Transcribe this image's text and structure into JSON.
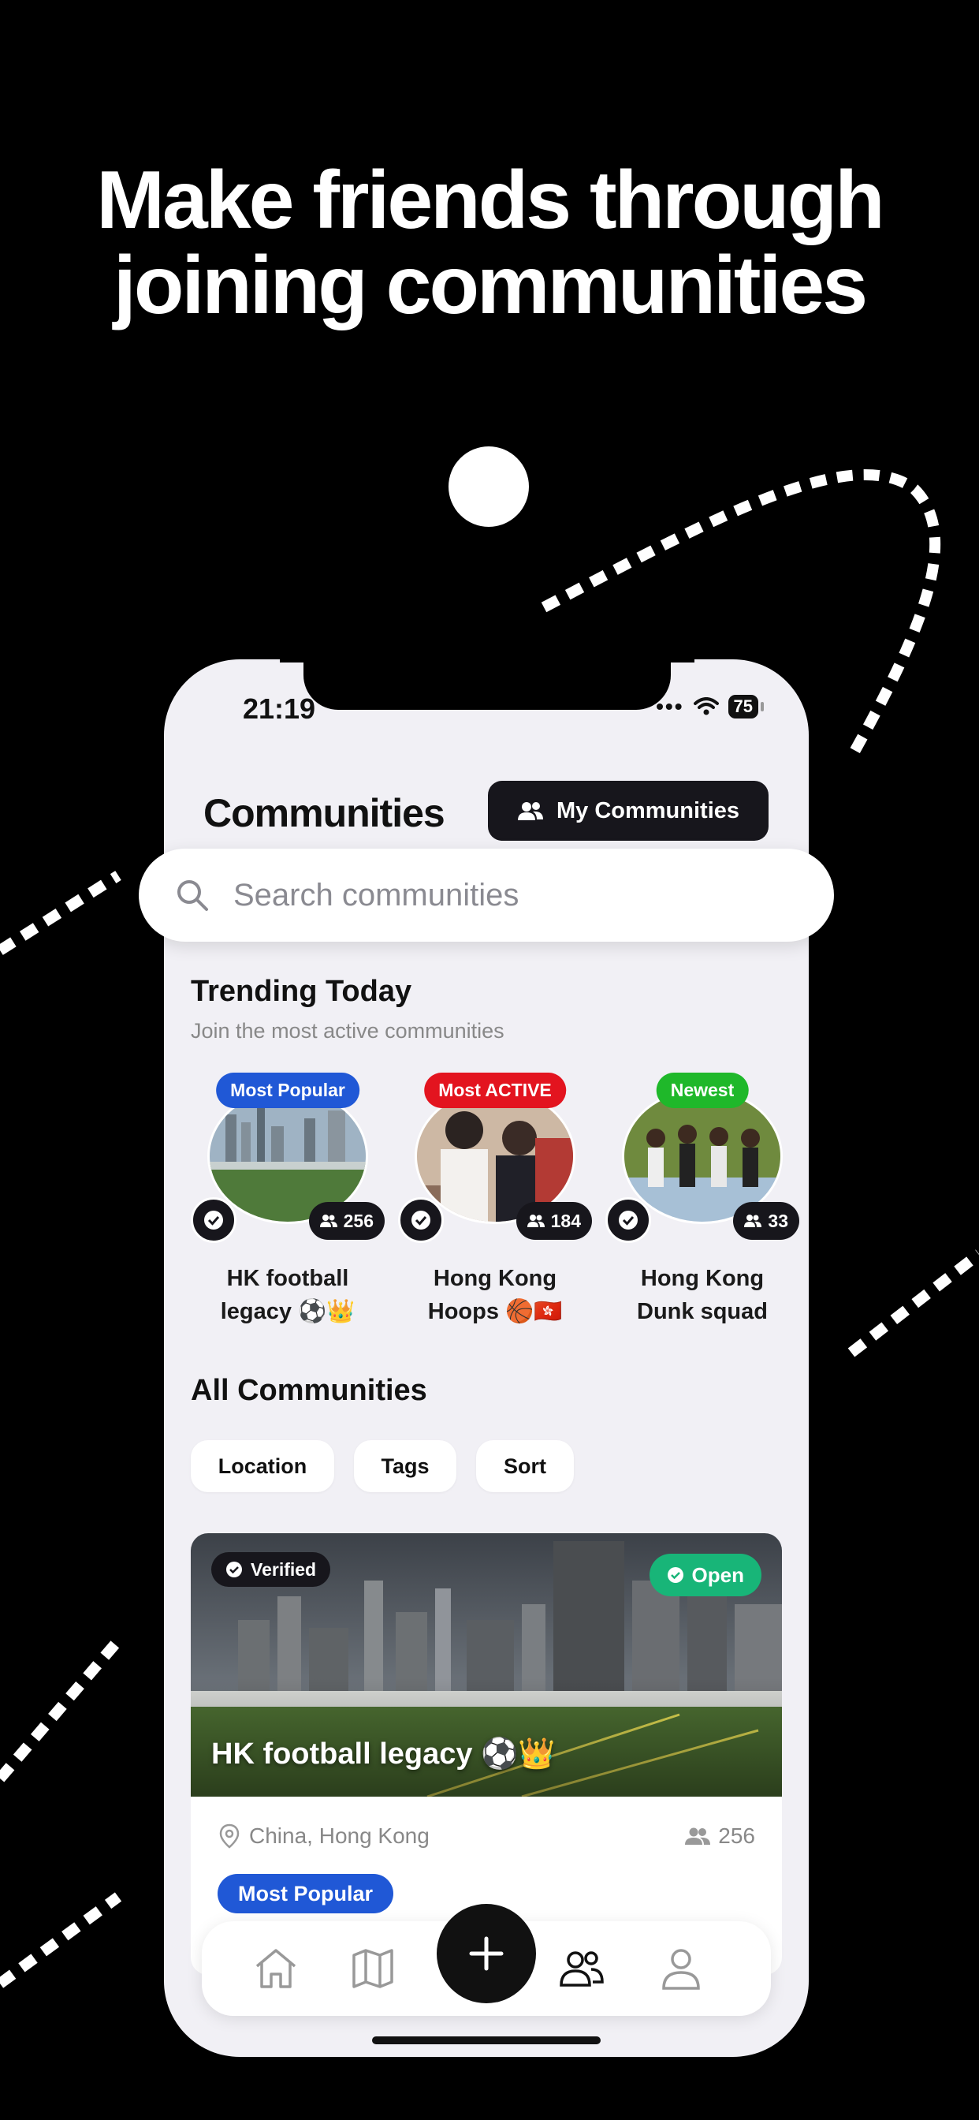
{
  "promo": {
    "headline_line1": "Make friends through",
    "headline_line2": "joining communities"
  },
  "status_bar": {
    "time": "21:19",
    "battery": "75"
  },
  "header": {
    "title": "Communities",
    "my_communities_label": "My Communities"
  },
  "search": {
    "placeholder": "Search communities"
  },
  "trending": {
    "title": "Trending Today",
    "subtitle": "Join the most active communities",
    "items": [
      {
        "badge": "Most Popular",
        "badge_color": "#2058d6",
        "count": "256",
        "name_line1": "HK football",
        "name_line2": "legacy ⚽️👑"
      },
      {
        "badge": "Most ACTIVE",
        "badge_color": "#e3141f",
        "count": "184",
        "name_line1": "Hong Kong",
        "name_line2": "Hoops 🏀🇭🇰"
      },
      {
        "badge": "Newest",
        "badge_color": "#1fb82a",
        "count": "33",
        "name_line1": "Hong Kong",
        "name_line2": "Dunk squad"
      }
    ]
  },
  "all_communities": {
    "title": "All Communities",
    "filters": [
      "Location",
      "Tags",
      "Sort"
    ]
  },
  "card": {
    "verified_label": "Verified",
    "open_label": "Open",
    "title": "HK football legacy ⚽️👑",
    "location": "China, Hong Kong",
    "member_count": "256",
    "tag": "Most Popular"
  },
  "tab_bar": {
    "icons": [
      "home-icon",
      "map-icon",
      "plus-icon",
      "people-icon",
      "profile-icon"
    ]
  },
  "colors": {
    "accent_dark": "#17161c",
    "open_green": "#18b578",
    "popular_blue": "#2058d6"
  }
}
